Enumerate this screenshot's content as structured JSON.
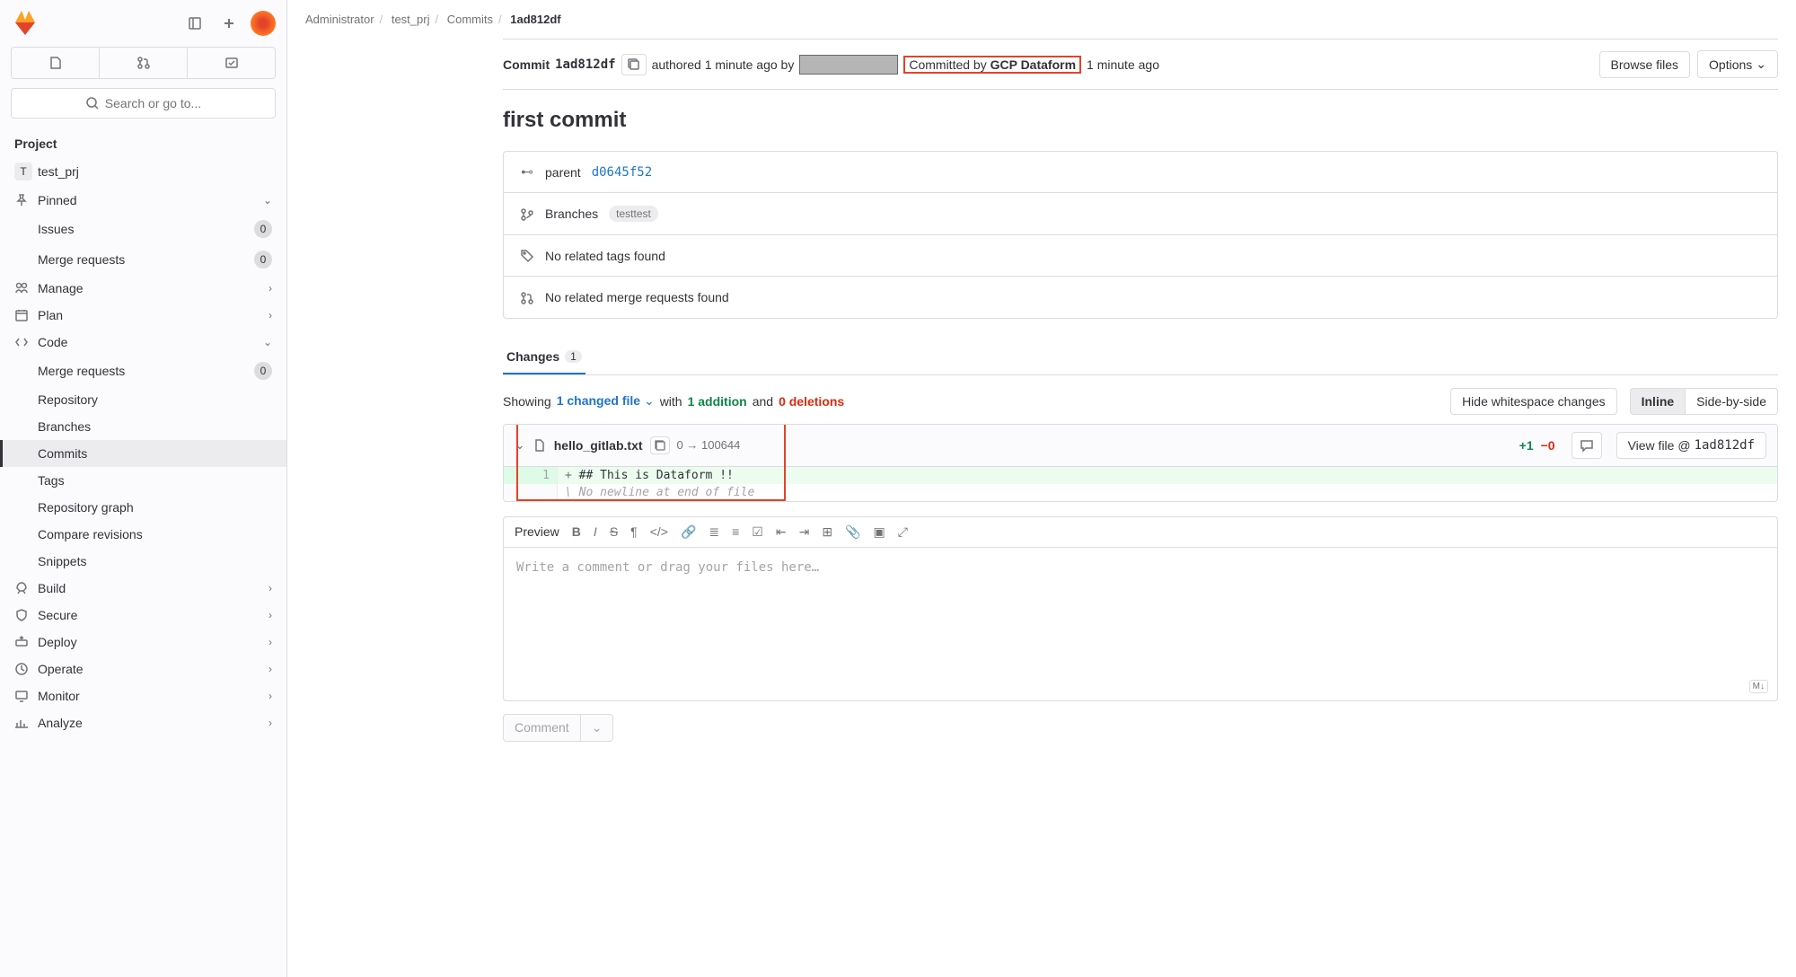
{
  "breadcrumbs": {
    "a": "Administrator",
    "b": "test_prj",
    "c": "Commits",
    "d": "1ad812df"
  },
  "sidebar": {
    "search_placeholder": "Search or go to...",
    "project_label": "Project",
    "project_name": "test_prj",
    "pinned": "Pinned",
    "issues": "Issues",
    "issues_count": "0",
    "mr": "Merge requests",
    "mr_count": "0",
    "manage": "Manage",
    "plan": "Plan",
    "code": "Code",
    "code_sub": {
      "mr": "Merge requests",
      "mr_count": "0",
      "repo": "Repository",
      "branches": "Branches",
      "commits": "Commits",
      "tags": "Tags",
      "graph": "Repository graph",
      "compare": "Compare revisions",
      "snippets": "Snippets"
    },
    "build": "Build",
    "secure": "Secure",
    "deploy": "Deploy",
    "operate": "Operate",
    "monitor": "Monitor",
    "analyze": "Analyze"
  },
  "commit": {
    "label": "Commit",
    "sha": "1ad812df",
    "authored": "authored 1 minute ago by",
    "committed_by": "Committed by",
    "committer": "GCP Dataform",
    "committed_ago": "1 minute ago",
    "browse": "Browse files",
    "options": "Options",
    "title": "first commit",
    "parent_label": "parent",
    "parent_sha": "d0645f52",
    "branches_label": "Branches",
    "branch_name": "testtest",
    "no_tags": "No related tags found",
    "no_mr": "No related merge requests found"
  },
  "changes": {
    "tab": "Changes",
    "count": "1",
    "showing": "Showing",
    "files": "1 changed file",
    "with": "with",
    "add": "1 addition",
    "and": "and",
    "del": "0 deletions",
    "hide_ws": "Hide whitespace changes",
    "inline": "Inline",
    "side": "Side-by-side"
  },
  "diff": {
    "file": "hello_gitlab.txt",
    "mode": "0 → 100644",
    "plus": "+1",
    "minus": "−0",
    "view": "View file @",
    "view_sha": "1ad812df",
    "line1_no": "1",
    "line1": "## This is Dataform !!",
    "nonewline": "\\ No newline at end of file"
  },
  "editor": {
    "preview": "Preview",
    "placeholder": "Write a comment or drag your files here…",
    "comment": "Comment"
  }
}
